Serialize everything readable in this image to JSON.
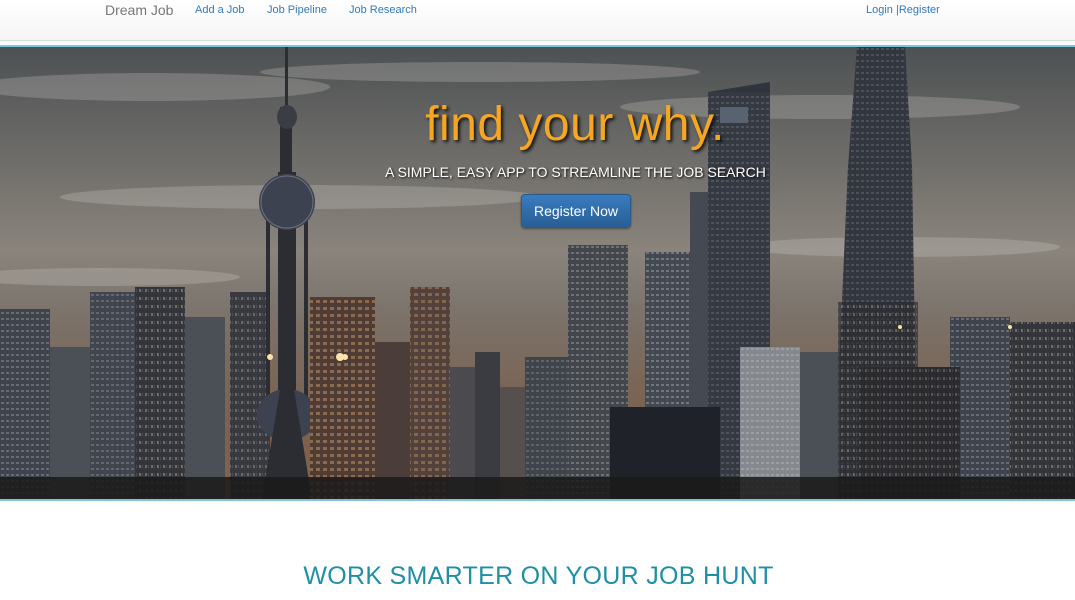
{
  "navbar": {
    "brand": "Dream Job",
    "links": [
      {
        "label": "Add a Job"
      },
      {
        "label": "Job Pipeline"
      },
      {
        "label": "Job Research"
      }
    ],
    "login": "Login",
    "separator": "|",
    "register": "Register"
  },
  "hero": {
    "title": "find your why.",
    "subtitle": "A SIMPLE, EASY APP TO STREAMLINE THE JOB SEARCH",
    "button_label": "Register Now"
  },
  "section": {
    "title": "WORK SMARTER ON YOUR JOB HUNT"
  },
  "colors": {
    "accent_orange": "#f5a623",
    "link_blue": "#337ab7",
    "section_teal": "#1e8fa8",
    "hero_border": "#7fc4dc"
  },
  "icons": {
    "hero_background": "city-skyline-image"
  }
}
